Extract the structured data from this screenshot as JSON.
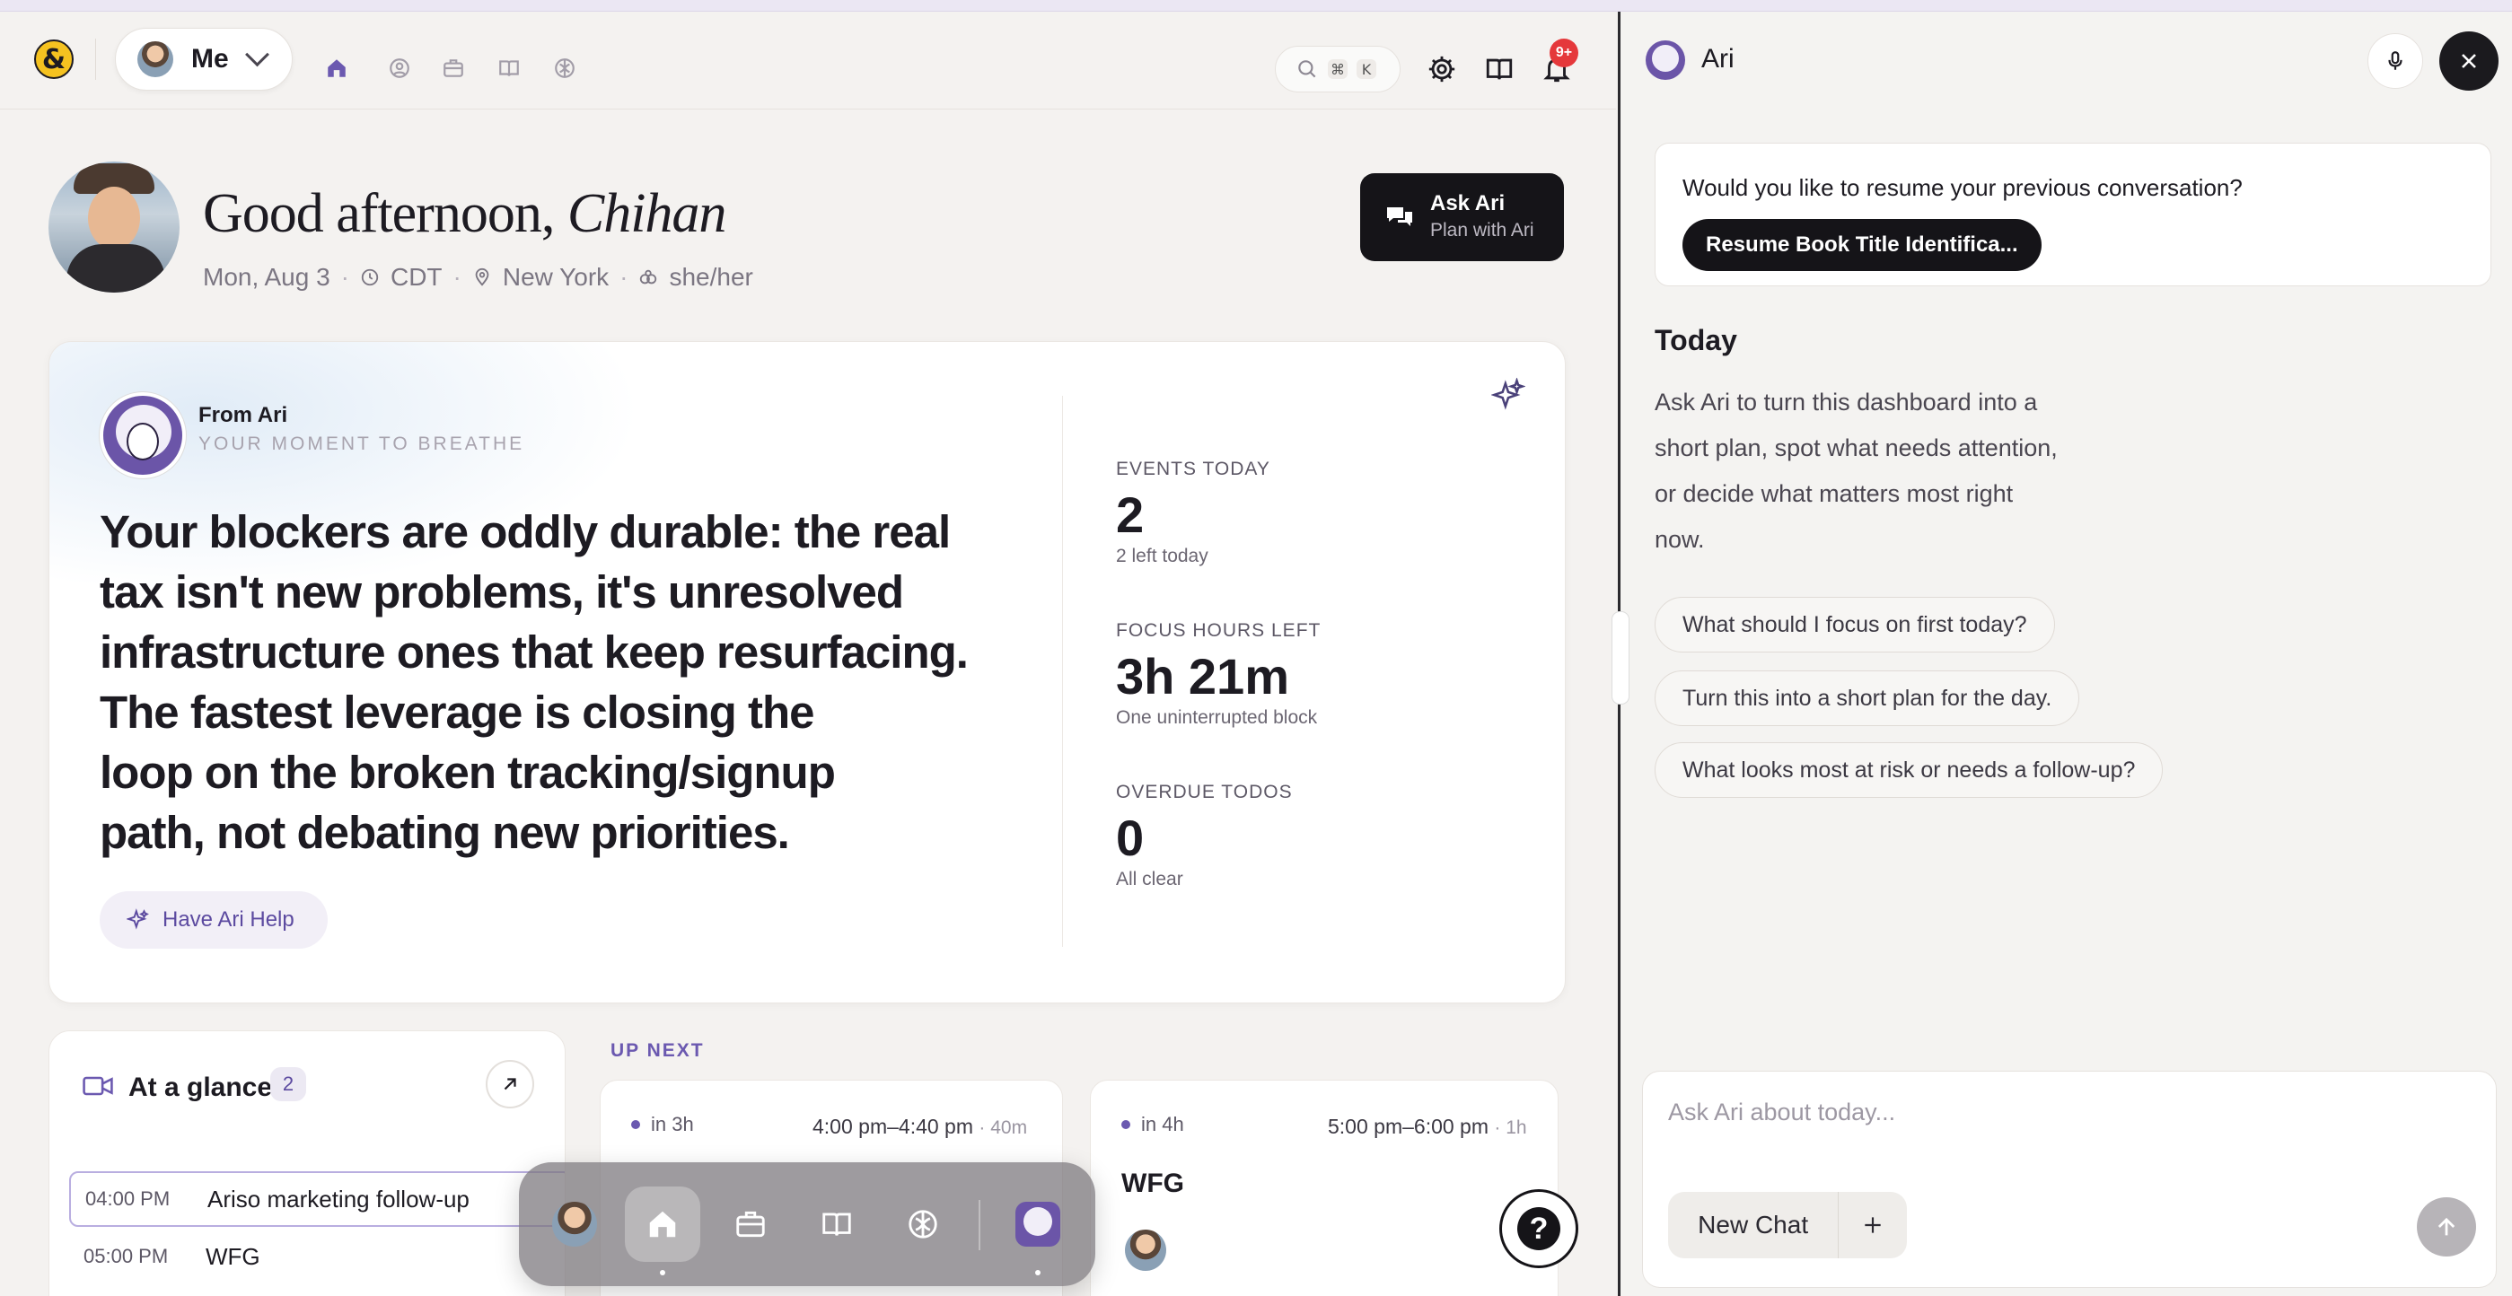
{
  "header": {
    "user_name": "Me",
    "notifications_badge": "9+",
    "search_keys": [
      "⌘",
      "K"
    ]
  },
  "greeting": {
    "prefix": "Good afternoon, ",
    "name": "Chihan",
    "date": "Mon, Aug 3",
    "timezone": "CDT",
    "location": "New York",
    "pronouns": "she/her"
  },
  "ask_button": {
    "title": "Ask Ari",
    "subtitle": "Plan with Ari"
  },
  "insight_card": {
    "from": "From Ari",
    "subtitle": "YOUR MOMENT TO BREATHE",
    "lines": [
      "Your blockers are oddly durable: the real",
      "tax isn't new problems, it's unresolved",
      "infrastructure ones that keep resurfacing.",
      "The fastest leverage is closing the",
      "loop on the broken tracking/signup",
      "path, not debating new priorities."
    ],
    "help_button": "Have Ari Help",
    "stats": [
      {
        "label": "EVENTS TODAY",
        "value": "2",
        "caption": "2 left today"
      },
      {
        "label": "FOCUS HOURS LEFT",
        "value": "3h 21m",
        "caption": "One uninterrupted block"
      },
      {
        "label": "OVERDUE TODOS",
        "value": "0",
        "caption": "All clear"
      }
    ]
  },
  "at_a_glance": {
    "title": "At a glance",
    "count": "2",
    "items": [
      {
        "time": "04:00 PM",
        "name": "Ariso marketing follow-up"
      },
      {
        "time": "05:00 PM",
        "name": "WFG"
      }
    ]
  },
  "up_next": {
    "label": "UP NEXT",
    "events": [
      {
        "when": "in 3h",
        "range": "4:00 pm–4:40 pm",
        "duration": "· 40m",
        "name": ""
      },
      {
        "when": "in 4h",
        "range": "5:00 pm–6:00 pm",
        "duration": "· 1h",
        "name": "WFG"
      }
    ]
  },
  "panel": {
    "title": "Ari",
    "resume_question": "Would you like to resume your previous conversation?",
    "resume_button": "Resume Book Title Identifica...",
    "today_heading": "Today",
    "today_text": "Ask Ari to turn this dashboard into a short plan, spot what needs attention, or decide what matters most right now.",
    "suggestions": [
      "What should I focus on first today?",
      "Turn this into a short plan for the day.",
      "What looks most at risk or needs a follow-up?"
    ],
    "composer_placeholder": "Ask Ari about today...",
    "new_chat": "New Chat"
  },
  "colors": {
    "accent": "#6b59b0",
    "dark": "#151418",
    "badge": "#e5383b",
    "logo": "#f5c220"
  }
}
